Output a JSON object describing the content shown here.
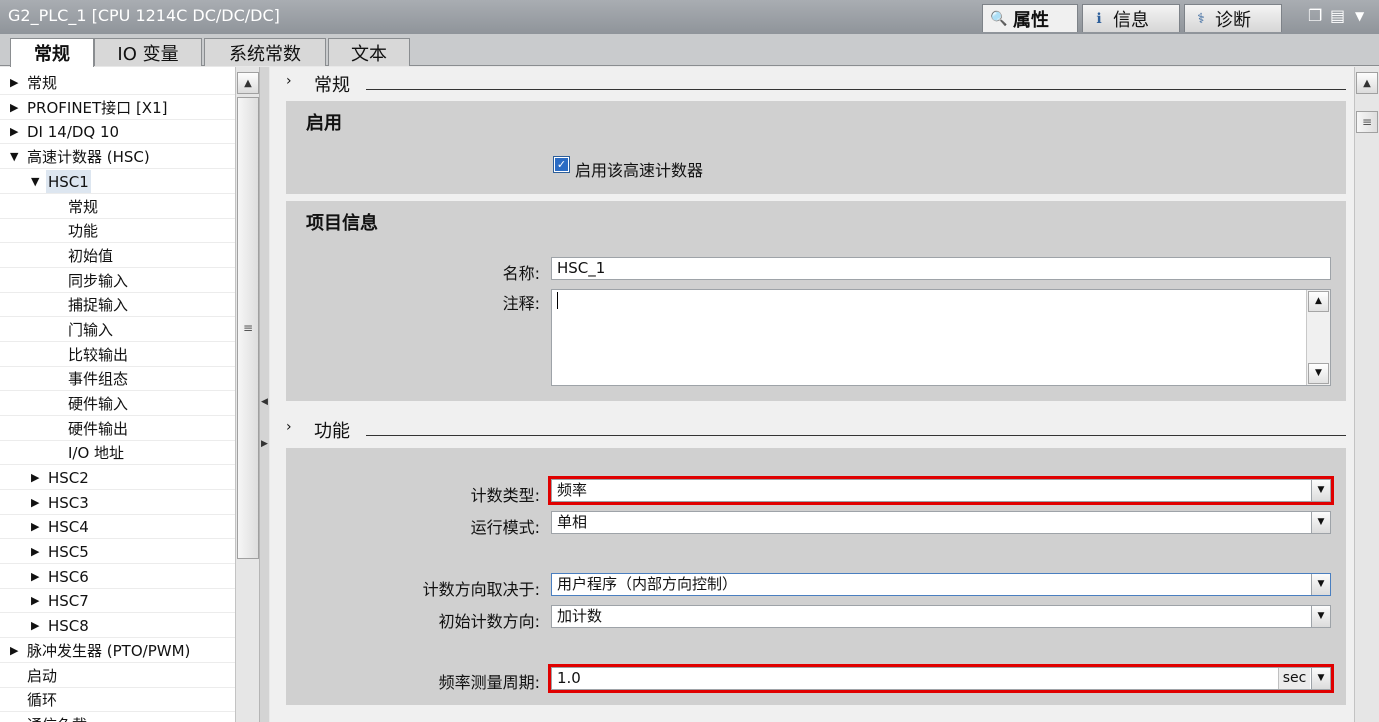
{
  "window": {
    "title": "G2_PLC_1 [CPU 1214C DC/DC/DC]",
    "top_tabs": [
      {
        "label": "属性",
        "icon": "properties-icon"
      },
      {
        "label": "信息",
        "icon": "info-icon"
      },
      {
        "label": "诊断",
        "icon": "diagnostics-icon"
      }
    ],
    "controls": [
      "restore-icon",
      "layout-icon",
      "dropdown-icon"
    ]
  },
  "sub_tabs": [
    "常规",
    "IO 变量",
    "系统常数",
    "文本"
  ],
  "tree": [
    {
      "label": "常规",
      "expanded": false
    },
    {
      "label": "PROFINET接口 [X1]",
      "expanded": false
    },
    {
      "label": "DI 14/DQ 10",
      "expanded": false
    },
    {
      "label": "高速计数器 (HSC)",
      "expanded": true
    },
    {
      "label": "HSC1",
      "expanded": true,
      "selected": true
    },
    {
      "label": "常规"
    },
    {
      "label": "功能"
    },
    {
      "label": "初始值"
    },
    {
      "label": "同步输入"
    },
    {
      "label": "捕捉输入"
    },
    {
      "label": "门输入"
    },
    {
      "label": "比较输出"
    },
    {
      "label": "事件组态"
    },
    {
      "label": "硬件输入"
    },
    {
      "label": "硬件输出"
    },
    {
      "label": "I/O 地址"
    },
    {
      "label": "HSC2",
      "expanded": false
    },
    {
      "label": "HSC3",
      "expanded": false
    },
    {
      "label": "HSC4",
      "expanded": false
    },
    {
      "label": "HSC5",
      "expanded": false
    },
    {
      "label": "HSC6",
      "expanded": false
    },
    {
      "label": "HSC7",
      "expanded": false
    },
    {
      "label": "HSC8",
      "expanded": false
    },
    {
      "label": "脉冲发生器 (PTO/PWM)",
      "expanded": false
    },
    {
      "label": "启动"
    },
    {
      "label": "循环"
    },
    {
      "label": "通信负载"
    }
  ],
  "sections": {
    "general": {
      "header": "常规",
      "enable": {
        "title": "启用",
        "checkbox_label": "启用该高速计数器",
        "checked": true
      },
      "project_info": {
        "title": "项目信息",
        "name_label": "名称:",
        "name_value": "HSC_1",
        "comment_label": "注释:",
        "comment_value": ""
      }
    },
    "function": {
      "header": "功能",
      "count_type_label": "计数类型:",
      "count_type_value": "频率",
      "op_mode_label": "运行模式:",
      "op_mode_value": "单相",
      "dir_source_label": "计数方向取决于:",
      "dir_source_value": "用户程序（内部方向控制）",
      "init_dir_label": "初始计数方向:",
      "init_dir_value": "加计数",
      "freq_period_label": "频率测量周期:",
      "freq_period_value": "1.0",
      "freq_period_unit": "sec"
    }
  },
  "colors": {
    "highlight_border": "#e00000",
    "checkbox": "#2b6cc4",
    "titlebar": "#9a9ea3"
  }
}
